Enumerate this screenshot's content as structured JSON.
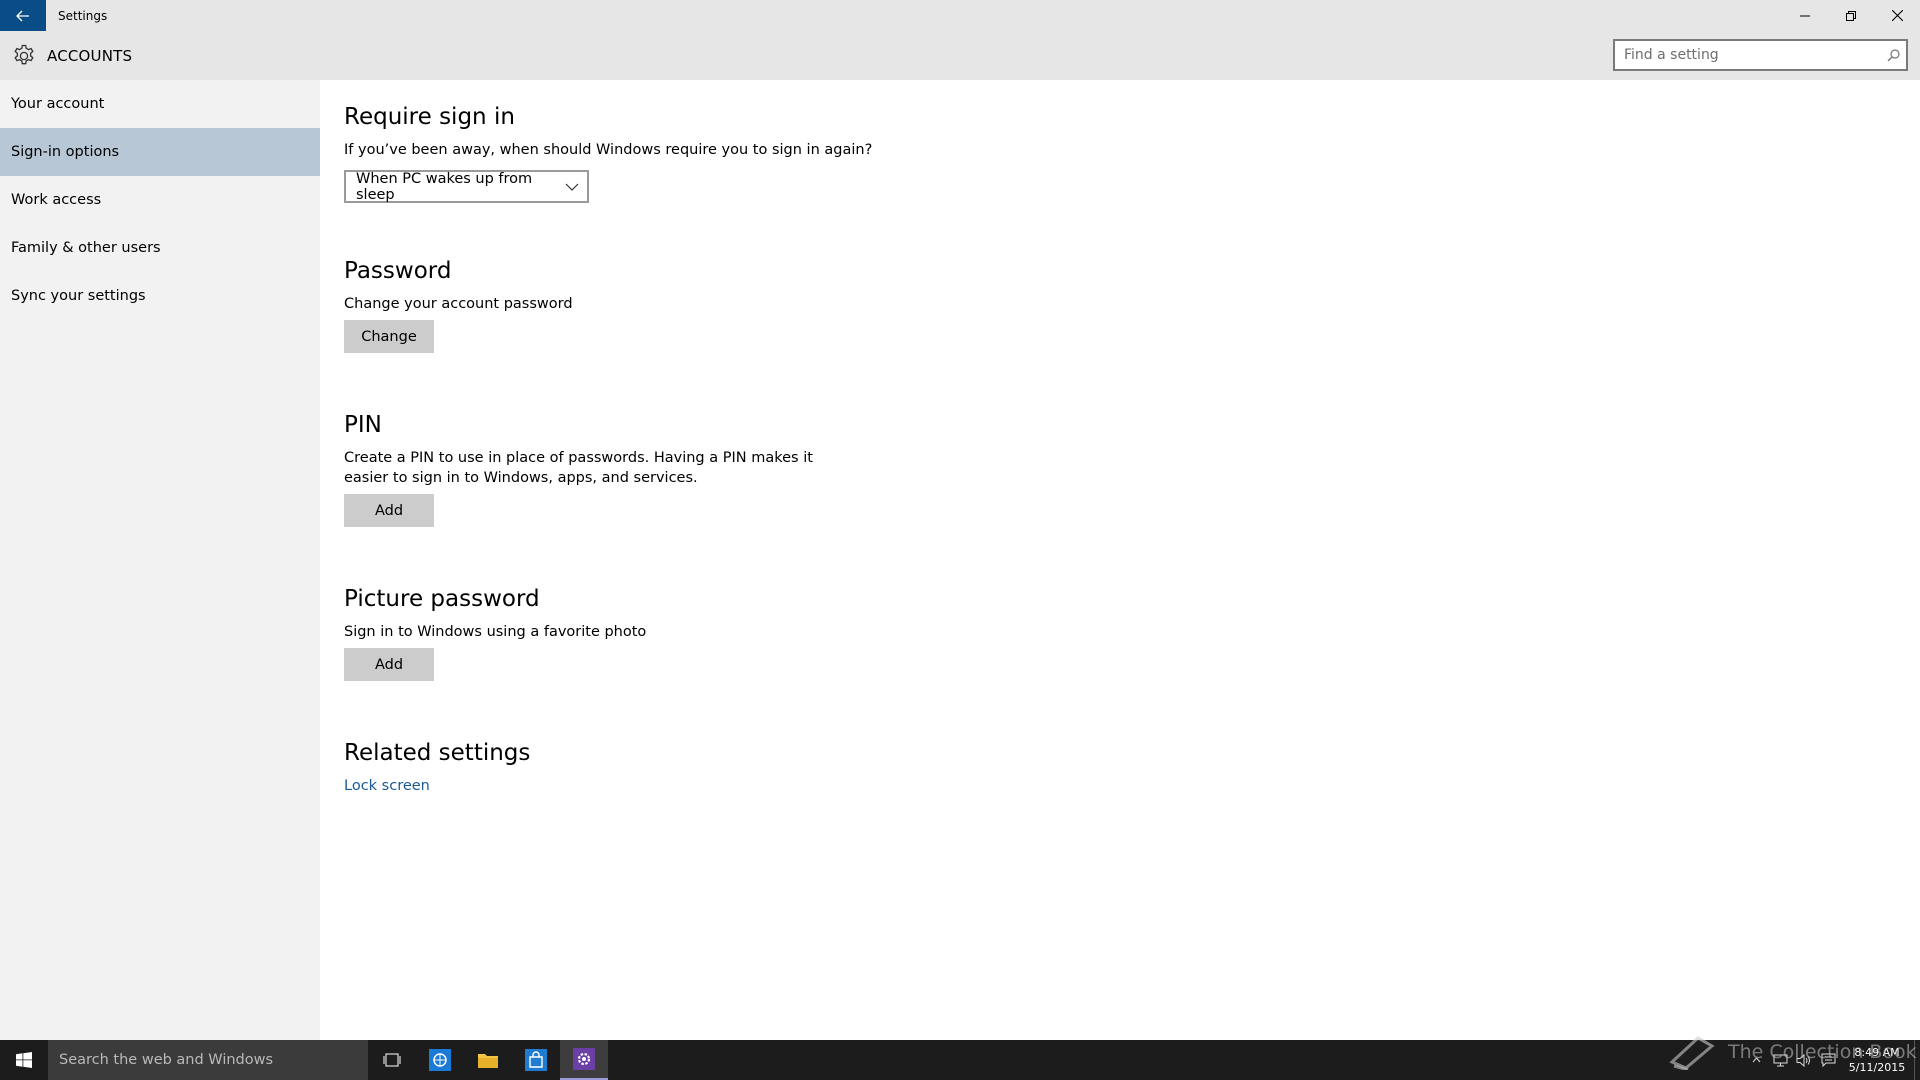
{
  "window": {
    "title": "Settings",
    "controls": [
      "minimize",
      "restore",
      "close"
    ]
  },
  "header": {
    "app_name": "ACCOUNTS",
    "search_placeholder": "Find a setting"
  },
  "sidebar": {
    "items": [
      {
        "label": "Your account",
        "active": false
      },
      {
        "label": "Sign-in options",
        "active": true
      },
      {
        "label": "Work access",
        "active": false
      },
      {
        "label": "Family & other users",
        "active": false
      },
      {
        "label": "Sync your settings",
        "active": false
      }
    ]
  },
  "main": {
    "require_sign_in": {
      "title": "Require sign in",
      "question": "If you’ve been away, when should Windows require you to sign in again?",
      "dropdown_value": "When PC wakes up from sleep"
    },
    "password": {
      "title": "Password",
      "desc": "Change your account password",
      "button": "Change"
    },
    "pin": {
      "title": "PIN",
      "desc_line1": "Create a PIN to use in place of passwords. Having a PIN makes it",
      "desc_line2": "easier to sign in to Windows, apps, and services.",
      "button": "Add"
    },
    "picture_password": {
      "title": "Picture password",
      "desc": "Sign in to Windows using a favorite photo",
      "button": "Add"
    },
    "related": {
      "title": "Related settings",
      "link": "Lock screen"
    }
  },
  "taskbar": {
    "search_text": "Search the web and Windows",
    "apps": [
      "task-view-icon",
      "edge-icon",
      "file-explorer-icon",
      "store-icon",
      "settings-icon"
    ],
    "clock_time": "8:49 AM",
    "clock_date": "5/11/2015",
    "watermark": "The Collection Book"
  },
  "colors": {
    "titlebar_bg": "#e6e6e6",
    "sidebar_bg": "#f2f2f2",
    "sidebar_active": "#b8c7d6",
    "back_button": "#0a4c86",
    "link": "#1a5a96",
    "button_bg": "#cccccc",
    "taskbar_bg": "#1c1c1c"
  }
}
